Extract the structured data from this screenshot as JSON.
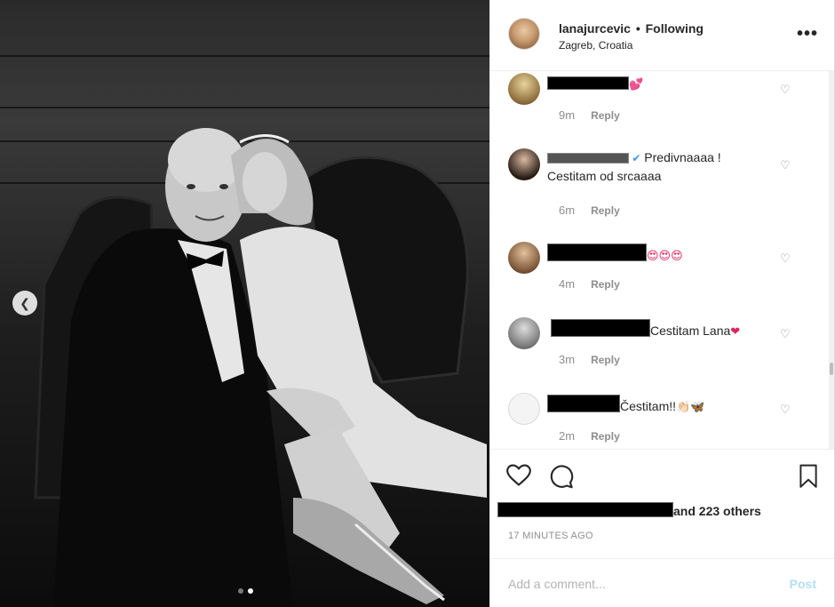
{
  "post": {
    "username": "lanajurcevic",
    "separator": "•",
    "follow_status": "Following",
    "location": "Zagreb, Croatia",
    "more_label": "•••"
  },
  "comments": [
    {
      "text": "",
      "emoji": "💕",
      "time": "9m",
      "reply": "Reply"
    },
    {
      "text": "Predivnaaaa !",
      "text2": "Cestitam od srcaaaa",
      "emoji": "",
      "time": "6m",
      "reply": "Reply"
    },
    {
      "text": "",
      "emoji": "😍😍😍",
      "time": "4m",
      "reply": "Reply"
    },
    {
      "text": "Cestitam Lana",
      "emoji": "❤",
      "time": "3m",
      "reply": "Reply"
    },
    {
      "text": "Čestitam!!",
      "emoji": "👏🏻🦋",
      "time": "2m",
      "reply": "Reply"
    }
  ],
  "likes": {
    "text": "and 223 others"
  },
  "time_ago": "17 MINUTES AGO",
  "add_comment": {
    "placeholder": "Add a comment...",
    "post_label": "Post"
  },
  "icons": {
    "heart": "heart-icon",
    "comment": "comment-icon",
    "bookmark": "bookmark-icon",
    "more": "more-icon",
    "prev": "chevron-left-icon"
  },
  "colors": {
    "link_blue": "#b2dffc",
    "meta_gray": "#8e8e8e",
    "text": "#262626"
  }
}
